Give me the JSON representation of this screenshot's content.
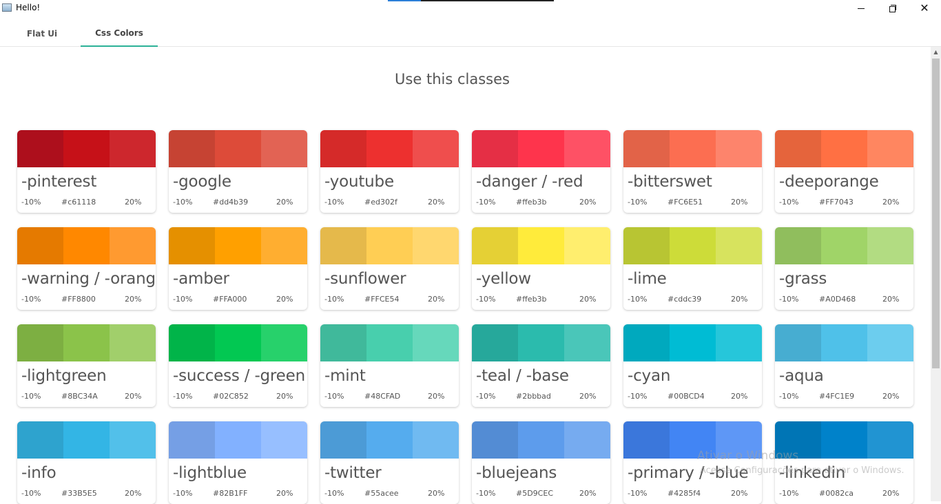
{
  "window": {
    "title": "Hello!",
    "progress_fraction": 0.2,
    "minimize_icon": "minimize-icon",
    "maximize_icon": "restore-icon",
    "close_icon": "close-icon",
    "close_glyph": "✕"
  },
  "tabs": [
    {
      "label": "Flat Ui",
      "selected": false
    },
    {
      "label": "Css Colors",
      "selected": true
    }
  ],
  "colors": {
    "tab_accent": "#2bb197"
  },
  "heading": "Use this classes",
  "scroll_up_glyph": "▲",
  "cards": [
    {
      "name": "-pinterest",
      "minus": "-10%",
      "hex": "#c61118",
      "plus": "20%",
      "swatches": [
        "#ad0f1c",
        "#c61118",
        "#cd272d"
      ]
    },
    {
      "name": "-google",
      "minus": "-10%",
      "hex": "#dd4b39",
      "plus": "20%",
      "swatches": [
        "#c64333",
        "#dd4b39",
        "#e26354"
      ]
    },
    {
      "name": "-youtube",
      "minus": "-10%",
      "hex": "#ed302f",
      "plus": "20%",
      "swatches": [
        "#d52a29",
        "#ed302f",
        "#ef4e4d"
      ]
    },
    {
      "name": "-danger / -red",
      "minus": "-10%",
      "hex": "#ffeb3b",
      "plus": "20%",
      "swatches": [
        "#e52f45",
        "#fe344c",
        "#fe5165"
      ]
    },
    {
      "name": "-bitterswet",
      "minus": "-10%",
      "hex": "#FC6E51",
      "plus": "20%",
      "swatches": [
        "#e26348",
        "#fc6e51",
        "#fd846c"
      ]
    },
    {
      "name": "-deeporange",
      "minus": "-10%",
      "hex": "#FF7043",
      "plus": "20%",
      "swatches": [
        "#e5643c",
        "#ff7043",
        "#ff8660"
      ]
    },
    {
      "name": "-warning / -orange",
      "minus": "-10%",
      "hex": "#FF8800",
      "plus": "20%",
      "swatches": [
        "#e57a00",
        "#ff8800",
        "#ff9a30"
      ]
    },
    {
      "name": "-amber",
      "minus": "-10%",
      "hex": "#FFA000",
      "plus": "20%",
      "swatches": [
        "#e59000",
        "#ffa000",
        "#ffae30"
      ]
    },
    {
      "name": "-sunflower",
      "minus": "-10%",
      "hex": "#FFCE54",
      "plus": "20%",
      "swatches": [
        "#e5b94b",
        "#ffce54",
        "#ffd76f"
      ]
    },
    {
      "name": "-yellow",
      "minus": "-10%",
      "hex": "#ffeb3b",
      "plus": "20%",
      "swatches": [
        "#e5d035",
        "#ffeb3b",
        "#ffee6e"
      ]
    },
    {
      "name": "-lime",
      "minus": "-10%",
      "hex": "#cddc39",
      "plus": "20%",
      "swatches": [
        "#b8c533",
        "#cddc39",
        "#d7e35e"
      ]
    },
    {
      "name": "-grass",
      "minus": "-10%",
      "hex": "#A0D468",
      "plus": "20%",
      "swatches": [
        "#90be5d",
        "#a0d468",
        "#b2dc82"
      ]
    },
    {
      "name": "-lightgreen",
      "minus": "-10%",
      "hex": "#8BC34A",
      "plus": "20%",
      "swatches": [
        "#7daf42",
        "#8bc34a",
        "#a1cf6b"
      ]
    },
    {
      "name": "-success / -green",
      "minus": "-10%",
      "hex": "#02C852",
      "plus": "20%",
      "swatches": [
        "#01b449",
        "#02c852",
        "#27d16b"
      ]
    },
    {
      "name": "-mint",
      "minus": "-10%",
      "hex": "#48CFAD",
      "plus": "20%",
      "swatches": [
        "#40b99b",
        "#48cfad",
        "#66d8bb"
      ]
    },
    {
      "name": "-teal / -base",
      "minus": "-10%",
      "hex": "#2bbbad",
      "plus": "20%",
      "swatches": [
        "#26a89b",
        "#2bbbad",
        "#4ac6b9"
      ]
    },
    {
      "name": "-cyan",
      "minus": "-10%",
      "hex": "#00BCD4",
      "plus": "20%",
      "swatches": [
        "#00a9be",
        "#00bcd4",
        "#26c6da"
      ]
    },
    {
      "name": "-aqua",
      "minus": "-10%",
      "hex": "#4FC1E9",
      "plus": "20%",
      "swatches": [
        "#47add1",
        "#4fc1e9",
        "#6ccdee"
      ]
    },
    {
      "name": "-info",
      "minus": "-10%",
      "hex": "#33B5E5",
      "plus": "20%",
      "swatches": [
        "#2ea3ce",
        "#33b5e5",
        "#52c0ea"
      ]
    },
    {
      "name": "-lightblue",
      "minus": "-10%",
      "hex": "#82B1FF",
      "plus": "20%",
      "swatches": [
        "#759fe5",
        "#82b1ff",
        "#97bfff"
      ]
    },
    {
      "name": "-twitter",
      "minus": "-10%",
      "hex": "#55acee",
      "plus": "20%",
      "swatches": [
        "#4c9bd6",
        "#55acee",
        "#70baf1"
      ]
    },
    {
      "name": "-bluejeans",
      "minus": "-10%",
      "hex": "#5D9CEC",
      "plus": "20%",
      "swatches": [
        "#538cd4",
        "#5d9cec",
        "#76abf0"
      ]
    },
    {
      "name": "-primary / -blue",
      "minus": "-10%",
      "hex": "#4285f4",
      "plus": "20%",
      "swatches": [
        "#3b77db",
        "#4285f4",
        "#5e97f6"
      ]
    },
    {
      "name": "-linkedin",
      "minus": "-10%",
      "hex": "#0082ca",
      "plus": "20%",
      "swatches": [
        "#0075b5",
        "#0082ca",
        "#2194d2"
      ]
    }
  ],
  "watermark": {
    "line1": "Ativar o Windows",
    "line2": "Acesse Configurações para ativar o Windows."
  }
}
